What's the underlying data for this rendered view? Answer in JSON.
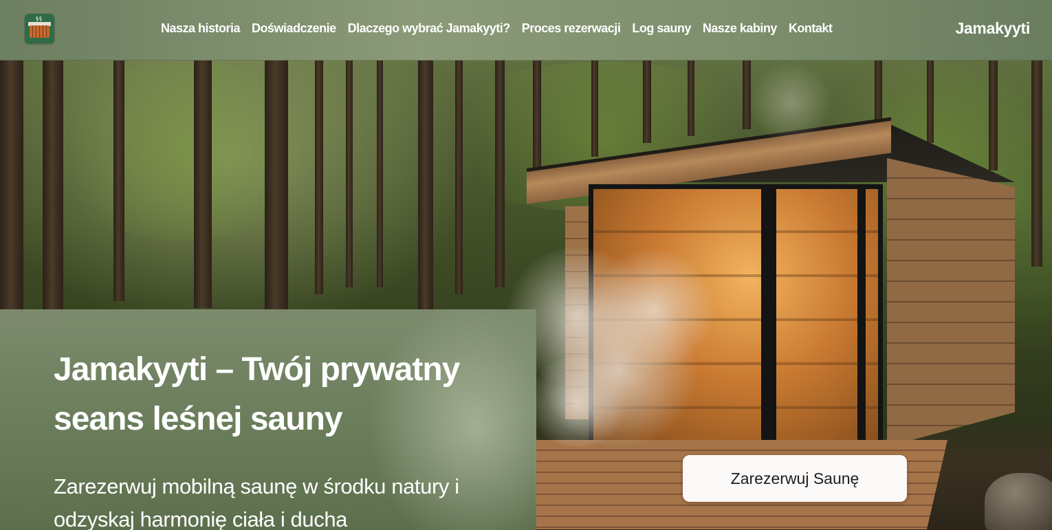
{
  "nav": {
    "logo_icon": "sauna-cabin-icon",
    "items": [
      "Nasza historia",
      "Doświadczenie",
      "Dlaczego wybrać Jamakyyti?",
      "Proces rezerwacji",
      "Log sauny",
      "Nasze kabiny",
      "Kontakt"
    ],
    "brand": "Jamakyyti"
  },
  "hero": {
    "title": "Jamakyyti – Twój prywatny seans leśnej sauny",
    "subtitle": "Zarezerwuj mobilną saunę w środku natury i odzyskaj harmonię ciała i ducha",
    "cta_label": "Zarezerwuj Saunę",
    "image": "forest-sauna-cabin-with-steam"
  },
  "colors": {
    "nav_bg": "#7d8f6c",
    "panel_bg": "#6e8260",
    "cta_bg": "#fbf9f7",
    "text": "#ffffff"
  }
}
